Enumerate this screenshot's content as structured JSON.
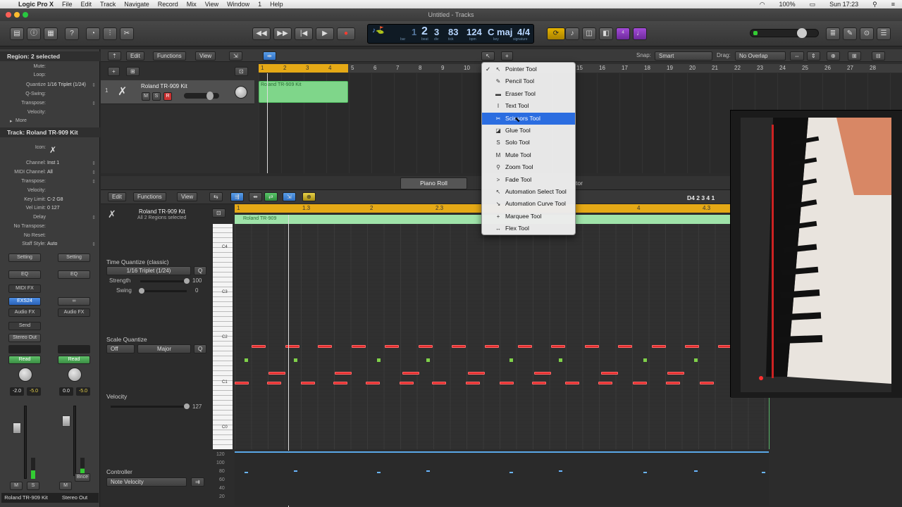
{
  "menubar": {
    "apple": "",
    "app": "Logic Pro X",
    "items": [
      "File",
      "Edit",
      "Track",
      "Navigate",
      "Record",
      "Mix",
      "View",
      "Window",
      "1",
      "Help"
    ],
    "battery": "100%",
    "clock": "Sun 17:23"
  },
  "window": {
    "title": "Untitled - Tracks"
  },
  "lcd": {
    "bar": "2",
    "beat": "3",
    "div": "83",
    "tick": "124",
    "bpm": "C maj",
    "sig": "4/4",
    "bar_label": "bar",
    "beat_label": "beat",
    "div_label": "div",
    "tick_label": "tick",
    "bpm_label": "bpm",
    "key_label": "key",
    "sig_label": "signature",
    "pos_small": "1",
    "tempo": "124",
    "key": "C maj",
    "signature": "4/4"
  },
  "inspector": {
    "region_header": "Region: 2 selected",
    "region_rows": [
      {
        "k": "Mute:",
        "v": ""
      },
      {
        "k": "Loop:",
        "v": ""
      },
      {
        "k": "Quantize",
        "v": "1/16 Triplet (1/24)"
      },
      {
        "k": "Q-Swing:",
        "v": ""
      },
      {
        "k": "Transpose:",
        "v": ""
      },
      {
        "k": "Velocity:",
        "v": ""
      }
    ],
    "more": "More",
    "track_header": "Track:  Roland TR-909 Kit",
    "icon_label": "Icon:",
    "track_rows": [
      {
        "k": "Channel:",
        "v": "Inst 1"
      },
      {
        "k": "MIDI Channel:",
        "v": "All"
      },
      {
        "k": "Transpose:",
        "v": ""
      },
      {
        "k": "Velocity:",
        "v": ""
      },
      {
        "k": "Key Limit:",
        "v": "C-2    G8"
      },
      {
        "k": "Vel Limit:",
        "v": "0    127"
      },
      {
        "k": "Delay",
        "v": ""
      },
      {
        "k": "No Transpose:",
        "v": ""
      },
      {
        "k": "No Reset:",
        "v": ""
      },
      {
        "k": "Staff Style:",
        "v": "Auto"
      }
    ],
    "strip1": {
      "setting": "Setting",
      "eq": "EQ",
      "midifx": "MIDI FX",
      "plugin": "EXS24",
      "audiofx": "Audio FX",
      "send": "Send",
      "output": "Stereo Out",
      "read": "Read",
      "pan_left": "-2.0",
      "pan_right": "-5.0",
      "m": "M",
      "s": "S",
      "name": "Roland TR-909 Kit"
    },
    "strip2": {
      "setting": "Setting",
      "eq": "EQ",
      "link": "∞",
      "audiofx": "Audio FX",
      "read": "Read",
      "pan_left": "0.0",
      "pan_right": "-5.0",
      "m": "M",
      "bnce": "Bnce",
      "name": "Stereo Out"
    }
  },
  "tracks": {
    "edit": "Edit",
    "functions": "Functions",
    "view": "View",
    "snap_label": "Snap:",
    "snap_value": "Smart",
    "drag_label": "Drag:",
    "drag_value": "No Overlap",
    "ruler": [
      "1",
      "2",
      "3",
      "4",
      "5",
      "6",
      "7",
      "8",
      "9",
      "10",
      "15",
      "16",
      "17",
      "18",
      "19",
      "20",
      "21",
      "22",
      "23",
      "24",
      "25",
      "26",
      "27",
      "28"
    ],
    "track_num": "1",
    "track_name": "Roland TR-909 Kit",
    "m": "M",
    "s": "S",
    "r": "R",
    "region_name": "Roland TR-909 Kit"
  },
  "pianoroll": {
    "tab": "Piano Roll",
    "tab2": "tor",
    "edit": "Edit",
    "functions": "Functions",
    "view": "View",
    "position": "D4   2 3 4 1",
    "ruler": [
      "1",
      "1.3",
      "2",
      "2.3",
      "3",
      "4",
      "4.3"
    ],
    "track_name": "Roland TR-909 Kit",
    "subtitle": "All 2 Regions selected",
    "region_label": "Roland TR-909",
    "tq_label": "Time Quantize (classic)",
    "tq_value": "1/16 Triplet (1/24)",
    "q": "Q",
    "strength_label": "Strength",
    "strength_value": "100",
    "swing_label": "Swing",
    "swing_value": "0",
    "sq_label": "Scale Quantize",
    "sq_off": "Off",
    "sq_scale": "Major",
    "velocity_label": "Velocity",
    "velocity_value": "127",
    "controller_label": "Controller",
    "controller_value": "Note Velocity",
    "octaves": [
      "C4",
      "C3",
      "C2",
      "C1",
      "C0"
    ],
    "vel_ticks": [
      "120",
      "100",
      "80",
      "60",
      "40",
      "20"
    ]
  },
  "tool_menu": {
    "items": [
      "Pointer Tool",
      "Pencil Tool",
      "Eraser Tool",
      "Text Tool",
      "Scissors Tool",
      "Glue Tool",
      "Solo Tool",
      "Mute Tool",
      "Zoom Tool",
      "Fade Tool",
      "Automation Select Tool",
      "Automation Curve Tool",
      "Marquee Tool",
      "Flex Tool"
    ],
    "icons": [
      "↖",
      "✎",
      "▬",
      "I",
      "✂",
      "◪",
      "S",
      "M",
      "⚲",
      ">",
      "↖",
      "↘",
      "+",
      "↔"
    ],
    "checked": "✓",
    "selected": "Scissors Tool"
  }
}
